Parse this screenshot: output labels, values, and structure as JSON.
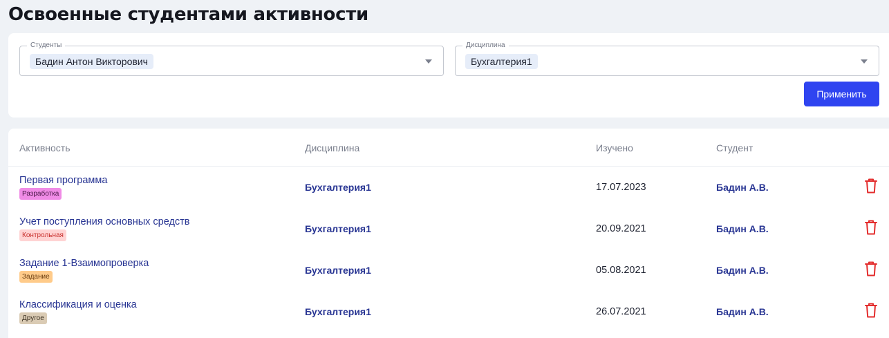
{
  "page": {
    "title": "Освоенные студентами активности"
  },
  "filters": {
    "students": {
      "legend": "Студенты",
      "selected": "Бадин Антон Викторович"
    },
    "discipline": {
      "legend": "Дисциплина",
      "selected": "Бухгалтерия1"
    },
    "apply_label": "Применить",
    "accent": "#2f44f0"
  },
  "table": {
    "columns": [
      "Активность",
      "Дисциплина",
      "Изучено",
      "Студент"
    ],
    "rows": [
      {
        "activity": "Первая программа",
        "tag": "Разработка",
        "tag_bg": "#f08be6",
        "tag_color": "#4a1848",
        "discipline": "Бухгалтерия1",
        "date": "17.07.2023",
        "student": "Бадин А.В."
      },
      {
        "activity": "Учет поступления основных средств",
        "tag": "Контрольная",
        "tag_bg": "#ffd3d3",
        "tag_color": "#c8312e",
        "discipline": "Бухгалтерия1",
        "date": "20.09.2021",
        "student": "Бадин А.В."
      },
      {
        "activity": "Задание 1-Взаимопроверка",
        "tag": "Задание",
        "tag_bg": "#ffcb8a",
        "tag_color": "#6a3d10",
        "discipline": "Бухгалтерия1",
        "date": "05.08.2021",
        "student": "Бадин А.В."
      },
      {
        "activity": "Классификация и оценка",
        "tag": "Другое",
        "tag_bg": "#dacbb4",
        "tag_color": "#3d3222",
        "discipline": "Бухгалтерия1",
        "date": "26.07.2021",
        "student": "Бадин А.В."
      }
    ],
    "delete_icon": "trash-icon",
    "delete_color": "#e32d2d"
  }
}
